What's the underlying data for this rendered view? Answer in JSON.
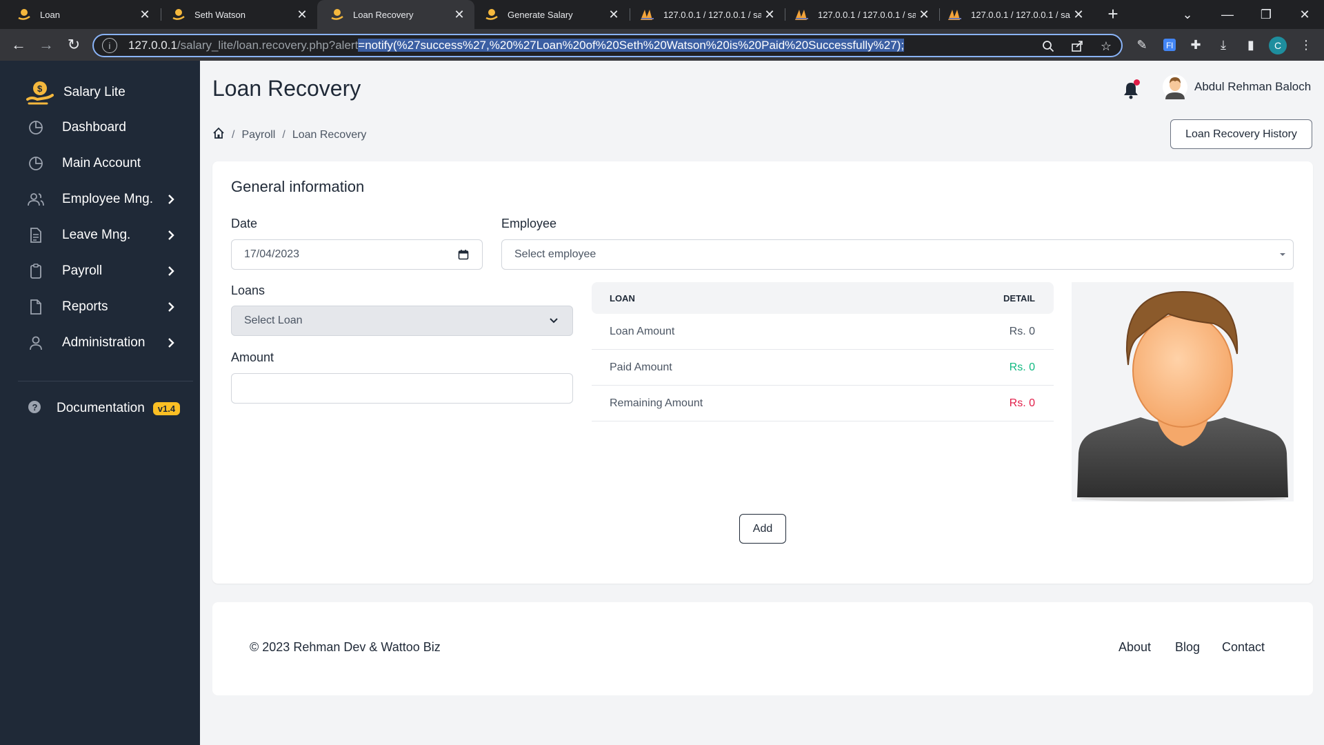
{
  "browser": {
    "tabs": [
      {
        "title": "Loan",
        "active": false
      },
      {
        "title": "Seth Watson",
        "active": false
      },
      {
        "title": "Loan Recovery",
        "active": true
      },
      {
        "title": "Generate Salary",
        "active": false
      },
      {
        "title": "127.0.0.1 / 127.0.0.1 / salar",
        "active": false
      },
      {
        "title": "127.0.0.1 / 127.0.0.1 / salar",
        "active": false
      },
      {
        "title": "127.0.0.1 / 127.0.0.1 / salar",
        "active": false
      }
    ],
    "url_host": "127.0.0.1",
    "url_path": "/salary_lite/loan.recovery.php?alert",
    "url_selected": "=notify(%27success%27,%20%27Loan%20of%20Seth%20Watson%20is%20Paid%20Successfully%27);",
    "profile_initial": "C"
  },
  "sidebar": {
    "brand": "Salary Lite",
    "items": [
      {
        "label": "Dashboard",
        "icon": "pie-chart-icon",
        "has_children": false
      },
      {
        "label": "Main Account",
        "icon": "pie-chart-icon",
        "has_children": false
      },
      {
        "label": "Employee Mng.",
        "icon": "users-icon",
        "has_children": true
      },
      {
        "label": "Leave Mng.",
        "icon": "document-icon",
        "has_children": true
      },
      {
        "label": "Payroll",
        "icon": "clipboard-icon",
        "has_children": true
      },
      {
        "label": "Reports",
        "icon": "file-icon",
        "has_children": true
      },
      {
        "label": "Administration",
        "icon": "user-icon",
        "has_children": true
      }
    ],
    "documentation": {
      "label": "Documentation",
      "badge": "v1.4"
    }
  },
  "header": {
    "title": "Loan Recovery",
    "user_name": "Abdul Rehman Baloch"
  },
  "breadcrumb": {
    "items": [
      "Payroll",
      "Loan Recovery"
    ]
  },
  "history_button": "Loan Recovery History",
  "form": {
    "section_title": "General information",
    "date_label": "Date",
    "date_value": "17/04/2023",
    "employee_label": "Employee",
    "employee_placeholder": "Select employee",
    "loans_label": "Loans",
    "loans_placeholder": "Select Loan",
    "amount_label": "Amount",
    "amount_value": "",
    "add_button": "Add"
  },
  "loan_table": {
    "headers": [
      "LOAN",
      "DETAIL"
    ],
    "rows": [
      {
        "label": "Loan Amount",
        "value": "Rs. 0",
        "color": "#4b5563"
      },
      {
        "label": "Paid Amount",
        "value": "Rs. 0",
        "color": "#10b981"
      },
      {
        "label": "Remaining Amount",
        "value": "Rs. 0",
        "color": "#e11d48"
      }
    ]
  },
  "footer": {
    "copyright_prefix": "© 2023",
    "copyright_owner": "Rehman Dev & Wattoo Biz",
    "links": [
      "About",
      "Blog",
      "Contact"
    ]
  }
}
